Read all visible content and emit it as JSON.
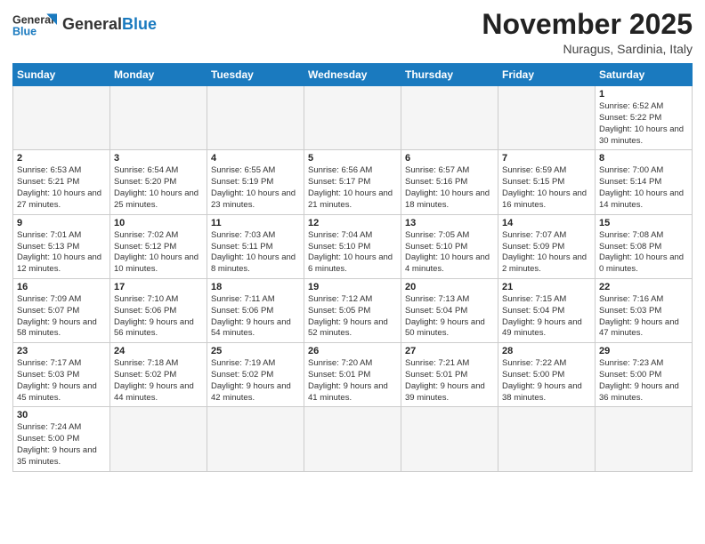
{
  "header": {
    "logo_general": "General",
    "logo_blue": "Blue",
    "month": "November 2025",
    "location": "Nuragus, Sardinia, Italy"
  },
  "weekdays": [
    "Sunday",
    "Monday",
    "Tuesday",
    "Wednesday",
    "Thursday",
    "Friday",
    "Saturday"
  ],
  "weeks": [
    [
      {
        "day": "",
        "info": ""
      },
      {
        "day": "",
        "info": ""
      },
      {
        "day": "",
        "info": ""
      },
      {
        "day": "",
        "info": ""
      },
      {
        "day": "",
        "info": ""
      },
      {
        "day": "",
        "info": ""
      },
      {
        "day": "1",
        "info": "Sunrise: 6:52 AM\nSunset: 5:22 PM\nDaylight: 10 hours and 30 minutes."
      }
    ],
    [
      {
        "day": "2",
        "info": "Sunrise: 6:53 AM\nSunset: 5:21 PM\nDaylight: 10 hours and 27 minutes."
      },
      {
        "day": "3",
        "info": "Sunrise: 6:54 AM\nSunset: 5:20 PM\nDaylight: 10 hours and 25 minutes."
      },
      {
        "day": "4",
        "info": "Sunrise: 6:55 AM\nSunset: 5:19 PM\nDaylight: 10 hours and 23 minutes."
      },
      {
        "day": "5",
        "info": "Sunrise: 6:56 AM\nSunset: 5:17 PM\nDaylight: 10 hours and 21 minutes."
      },
      {
        "day": "6",
        "info": "Sunrise: 6:57 AM\nSunset: 5:16 PM\nDaylight: 10 hours and 18 minutes."
      },
      {
        "day": "7",
        "info": "Sunrise: 6:59 AM\nSunset: 5:15 PM\nDaylight: 10 hours and 16 minutes."
      },
      {
        "day": "8",
        "info": "Sunrise: 7:00 AM\nSunset: 5:14 PM\nDaylight: 10 hours and 14 minutes."
      }
    ],
    [
      {
        "day": "9",
        "info": "Sunrise: 7:01 AM\nSunset: 5:13 PM\nDaylight: 10 hours and 12 minutes."
      },
      {
        "day": "10",
        "info": "Sunrise: 7:02 AM\nSunset: 5:12 PM\nDaylight: 10 hours and 10 minutes."
      },
      {
        "day": "11",
        "info": "Sunrise: 7:03 AM\nSunset: 5:11 PM\nDaylight: 10 hours and 8 minutes."
      },
      {
        "day": "12",
        "info": "Sunrise: 7:04 AM\nSunset: 5:10 PM\nDaylight: 10 hours and 6 minutes."
      },
      {
        "day": "13",
        "info": "Sunrise: 7:05 AM\nSunset: 5:10 PM\nDaylight: 10 hours and 4 minutes."
      },
      {
        "day": "14",
        "info": "Sunrise: 7:07 AM\nSunset: 5:09 PM\nDaylight: 10 hours and 2 minutes."
      },
      {
        "day": "15",
        "info": "Sunrise: 7:08 AM\nSunset: 5:08 PM\nDaylight: 10 hours and 0 minutes."
      }
    ],
    [
      {
        "day": "16",
        "info": "Sunrise: 7:09 AM\nSunset: 5:07 PM\nDaylight: 9 hours and 58 minutes."
      },
      {
        "day": "17",
        "info": "Sunrise: 7:10 AM\nSunset: 5:06 PM\nDaylight: 9 hours and 56 minutes."
      },
      {
        "day": "18",
        "info": "Sunrise: 7:11 AM\nSunset: 5:06 PM\nDaylight: 9 hours and 54 minutes."
      },
      {
        "day": "19",
        "info": "Sunrise: 7:12 AM\nSunset: 5:05 PM\nDaylight: 9 hours and 52 minutes."
      },
      {
        "day": "20",
        "info": "Sunrise: 7:13 AM\nSunset: 5:04 PM\nDaylight: 9 hours and 50 minutes."
      },
      {
        "day": "21",
        "info": "Sunrise: 7:15 AM\nSunset: 5:04 PM\nDaylight: 9 hours and 49 minutes."
      },
      {
        "day": "22",
        "info": "Sunrise: 7:16 AM\nSunset: 5:03 PM\nDaylight: 9 hours and 47 minutes."
      }
    ],
    [
      {
        "day": "23",
        "info": "Sunrise: 7:17 AM\nSunset: 5:03 PM\nDaylight: 9 hours and 45 minutes."
      },
      {
        "day": "24",
        "info": "Sunrise: 7:18 AM\nSunset: 5:02 PM\nDaylight: 9 hours and 44 minutes."
      },
      {
        "day": "25",
        "info": "Sunrise: 7:19 AM\nSunset: 5:02 PM\nDaylight: 9 hours and 42 minutes."
      },
      {
        "day": "26",
        "info": "Sunrise: 7:20 AM\nSunset: 5:01 PM\nDaylight: 9 hours and 41 minutes."
      },
      {
        "day": "27",
        "info": "Sunrise: 7:21 AM\nSunset: 5:01 PM\nDaylight: 9 hours and 39 minutes."
      },
      {
        "day": "28",
        "info": "Sunrise: 7:22 AM\nSunset: 5:00 PM\nDaylight: 9 hours and 38 minutes."
      },
      {
        "day": "29",
        "info": "Sunrise: 7:23 AM\nSunset: 5:00 PM\nDaylight: 9 hours and 36 minutes."
      }
    ],
    [
      {
        "day": "30",
        "info": "Sunrise: 7:24 AM\nSunset: 5:00 PM\nDaylight: 9 hours and 35 minutes."
      },
      {
        "day": "",
        "info": ""
      },
      {
        "day": "",
        "info": ""
      },
      {
        "day": "",
        "info": ""
      },
      {
        "day": "",
        "info": ""
      },
      {
        "day": "",
        "info": ""
      },
      {
        "day": "",
        "info": ""
      }
    ]
  ]
}
